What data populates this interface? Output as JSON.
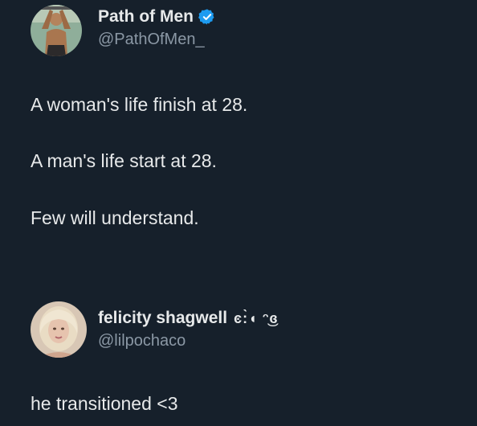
{
  "post": {
    "author": {
      "display_name": "Path of Men",
      "handle": "@PathOfMen_",
      "verified": true,
      "avatar_icon": "muscular-man-avatar"
    },
    "lines": [
      "A woman's life finish at 28.",
      "A man's life start at 28.",
      "Few will understand."
    ]
  },
  "reply": {
    "author": {
      "display_name": "felicity shagwell",
      "display_name_decoration": "ͼ:̀◖ ᵔ͜ɞ",
      "handle": "@lilpochaco",
      "avatar_icon": "blonde-woman-avatar"
    },
    "text": "he transitioned <3"
  },
  "colors": {
    "background": "#16202b",
    "text_primary": "#e7e9ea",
    "text_secondary": "#8b98a5",
    "verified_blue": "#1d9bf0"
  }
}
